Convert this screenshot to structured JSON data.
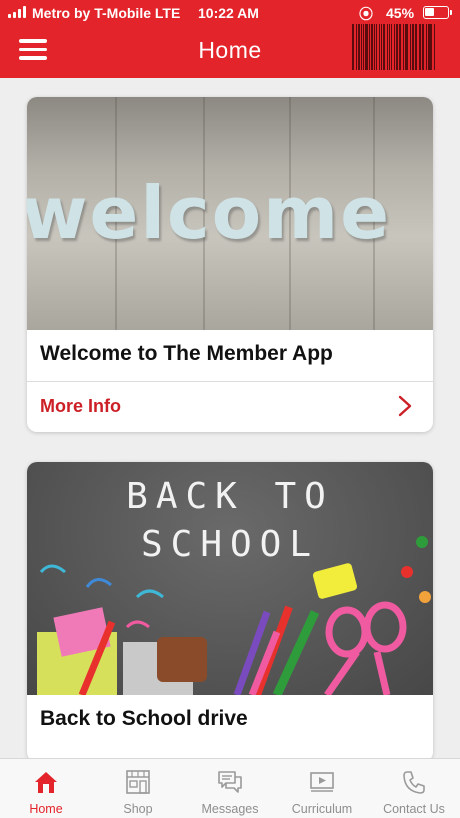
{
  "status_bar": {
    "carrier": "Metro by T-Mobile  LTE",
    "time": "10:22 AM",
    "battery": "45%",
    "battery_level": 0.45
  },
  "header": {
    "title": "Home",
    "menu_icon": "hamburger-icon",
    "barcode_icon": "barcode-icon"
  },
  "cards": [
    {
      "title": "Welcome to The Member App",
      "link_label": "More Info",
      "image_text": "welcome"
    },
    {
      "title": "Back to School drive",
      "image_text_line1": "BACK TO",
      "image_text_line2": "SCHOOL"
    }
  ],
  "tabs": [
    {
      "label": "Home",
      "icon": "home-icon",
      "active": true
    },
    {
      "label": "Shop",
      "icon": "shop-icon",
      "active": false
    },
    {
      "label": "Messages",
      "icon": "messages-icon",
      "active": false
    },
    {
      "label": "Curriculum",
      "icon": "video-icon",
      "active": false
    },
    {
      "label": "Contact Us",
      "icon": "phone-icon",
      "active": false
    }
  ],
  "colors": {
    "brand_red": "#e3242b",
    "link_red": "#cc1f26",
    "tab_inactive": "#8e8e8e"
  }
}
